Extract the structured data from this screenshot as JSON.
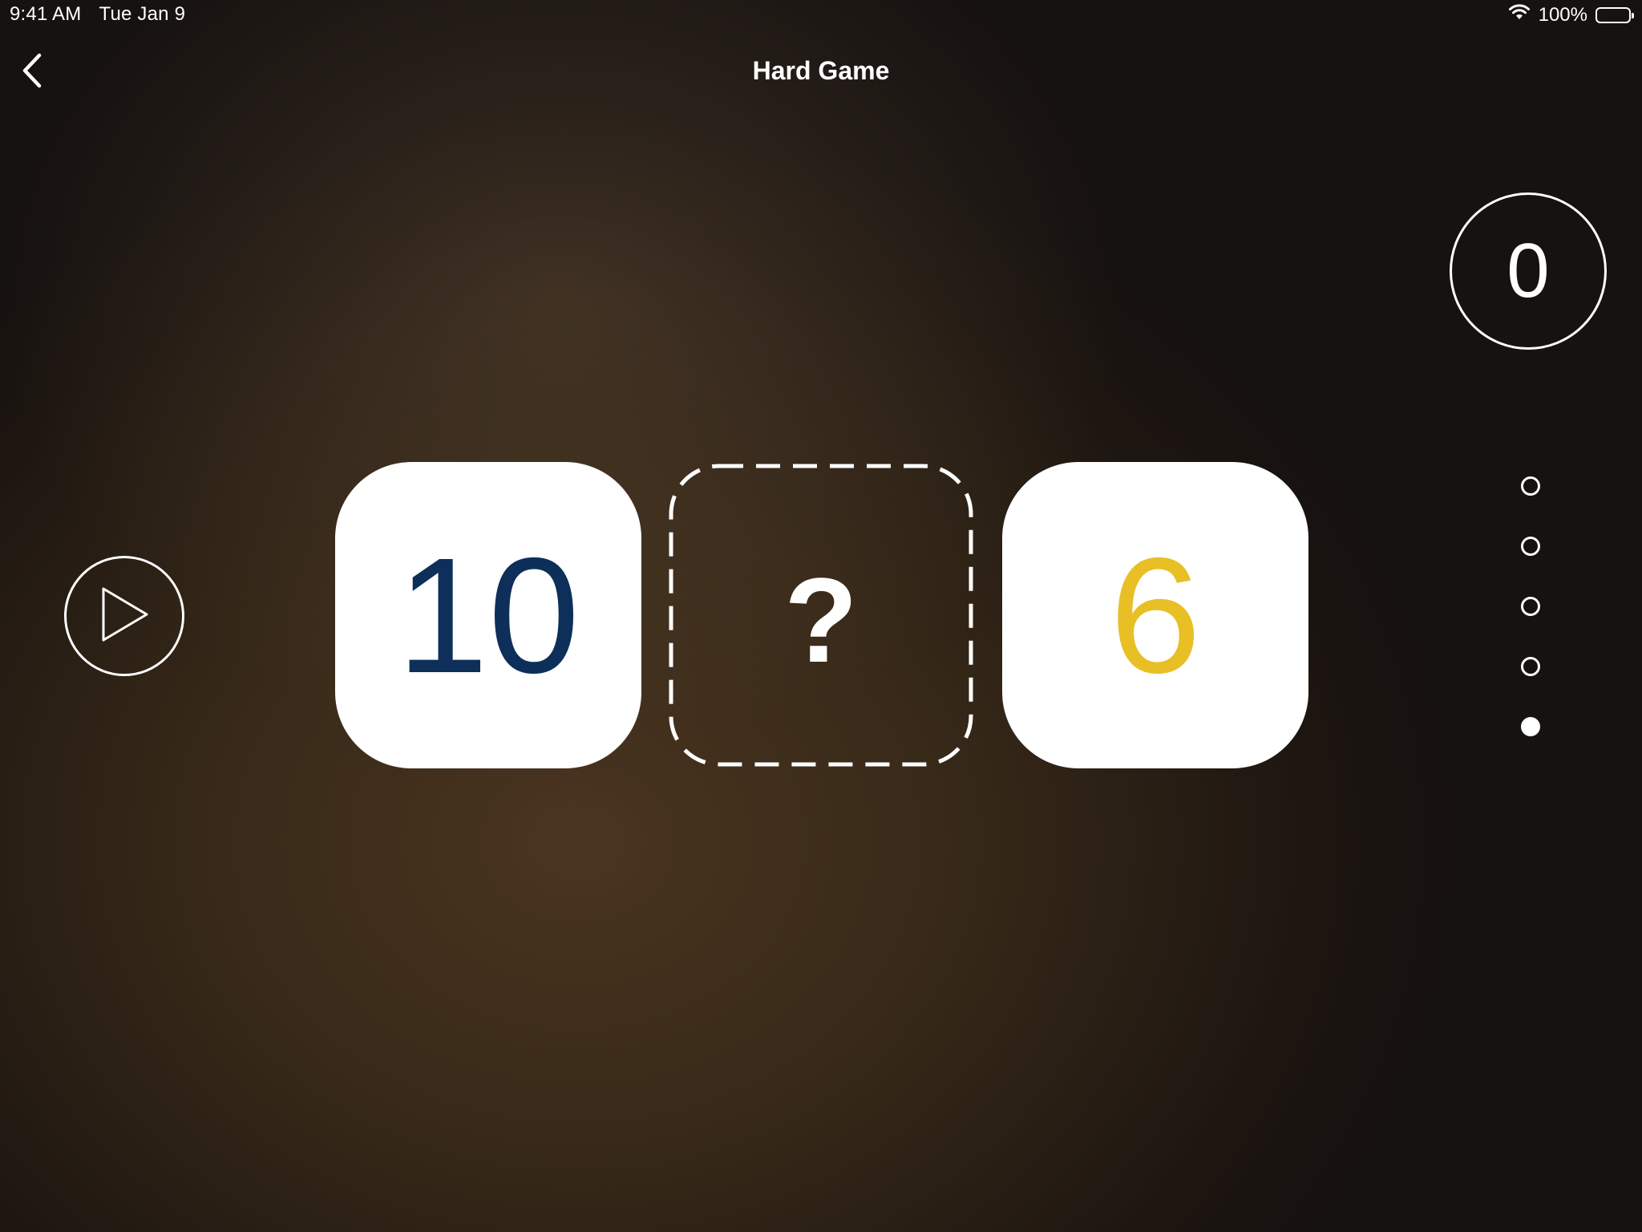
{
  "status_bar": {
    "time": "9:41 AM",
    "date": "Tue Jan 9",
    "battery": "100%",
    "icons": [
      "wifi-icon",
      "battery-icon"
    ]
  },
  "nav": {
    "back_icon": "chevron-left-icon",
    "title": "Hard Game"
  },
  "game": {
    "score": "0",
    "left_number": "10",
    "answer_placeholder": "?",
    "right_number": "6",
    "play_icon": "play-icon",
    "progress": {
      "total": 5,
      "current": 5
    },
    "colors": {
      "left_number": "#0d2f5a",
      "right_number": "#e8bf25",
      "card_bg": "#ffffff"
    }
  }
}
